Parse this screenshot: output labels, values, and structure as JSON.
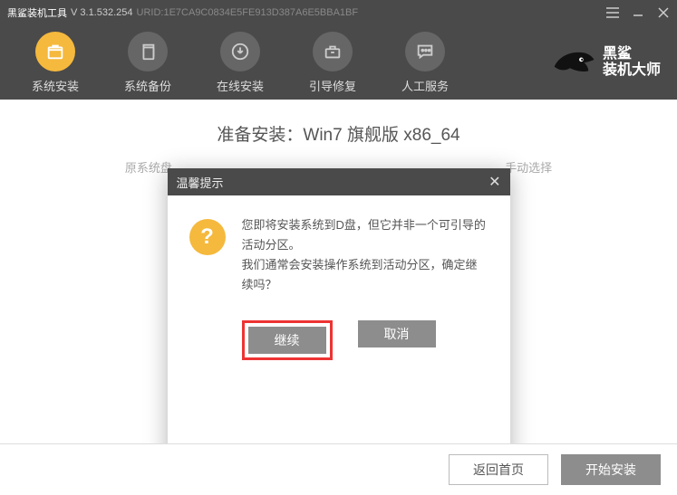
{
  "titlebar": {
    "appname": "黑鲨装机工具",
    "version": "V 3.1.532.254",
    "urid": "URID:1E7CA9C0834E5FE913D387A6E5BBA1BF"
  },
  "nav": {
    "items": [
      {
        "label": "系统安装",
        "icon": "box"
      },
      {
        "label": "系统备份",
        "icon": "copy"
      },
      {
        "label": "在线安装",
        "icon": "download"
      },
      {
        "label": "引导修复",
        "icon": "toolbox"
      },
      {
        "label": "人工服务",
        "icon": "chat"
      }
    ]
  },
  "brand": {
    "line1": "黑鲨",
    "line2": "装机大师"
  },
  "content": {
    "prepare_title": "准备安装：Win7 旗舰版 x86_64",
    "subline_left": "原系统盘",
    "subline_right": "手动选择"
  },
  "dialog": {
    "title": "温馨提示",
    "message_line1": "您即将安装系统到D盘，但它并非一个可引导的活动分区。",
    "message_line2": "我们通常会安装操作系统到活动分区，确定继续吗？",
    "continue_label": "继续",
    "cancel_label": "取消"
  },
  "footer": {
    "back_label": "返回首页",
    "start_label": "开始安装"
  }
}
